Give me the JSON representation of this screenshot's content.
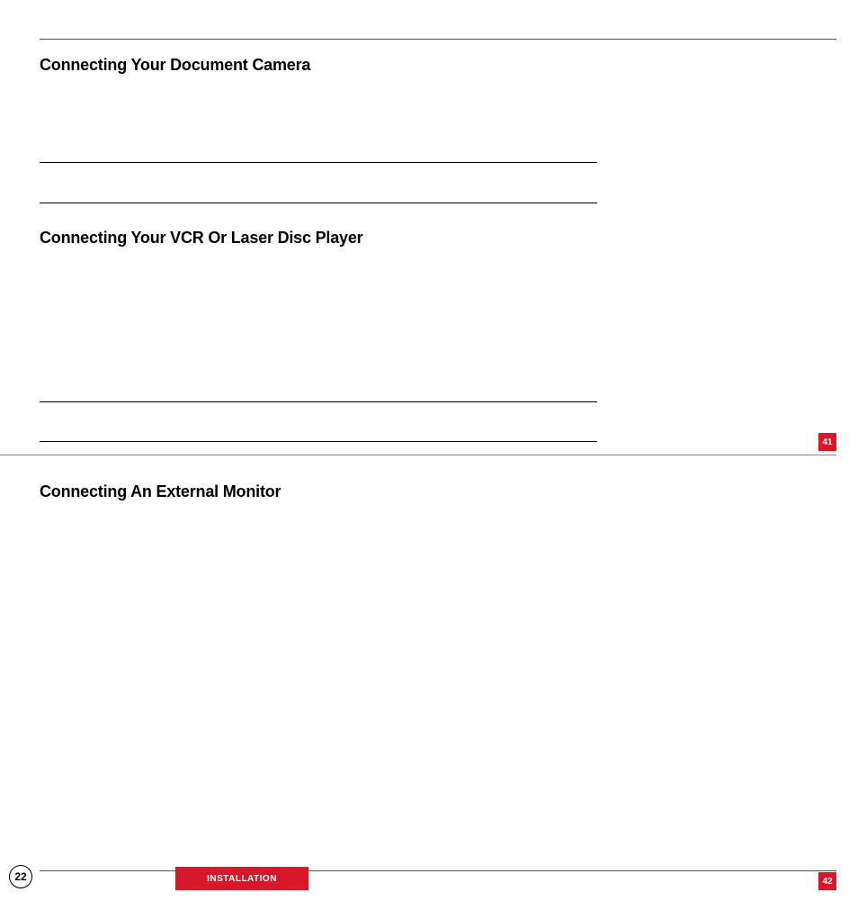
{
  "headings": {
    "h1": "Connecting Your Document Camera",
    "h2": "Connecting Your VCR Or Laser Disc Player",
    "h3": "Connecting An External Monitor"
  },
  "badges": {
    "side_upper": "41",
    "side_lower": "42"
  },
  "footer": {
    "page_number": "22",
    "tab_label": "INSTALLATION"
  }
}
